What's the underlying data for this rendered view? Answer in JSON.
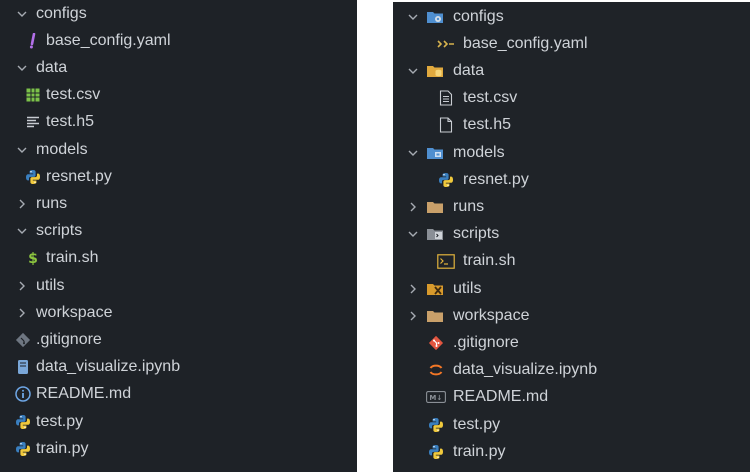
{
  "left_explorer": {
    "items": [
      {
        "label": "configs",
        "icon": "chevron-down-icon",
        "type": "folder-open",
        "depth": 0
      },
      {
        "label": "base_config.yaml",
        "icon": "yaml-exclamation-icon",
        "type": "file",
        "depth": 1
      },
      {
        "label": "data",
        "icon": "chevron-down-icon",
        "type": "folder-open",
        "depth": 0
      },
      {
        "label": "test.csv",
        "icon": "csv-grid-icon",
        "type": "file",
        "depth": 1
      },
      {
        "label": "test.h5",
        "icon": "text-lines-icon",
        "type": "file",
        "depth": 1
      },
      {
        "label": "models",
        "icon": "chevron-down-icon",
        "type": "folder-open",
        "depth": 0
      },
      {
        "label": "resnet.py",
        "icon": "python-icon",
        "type": "file",
        "depth": 1
      },
      {
        "label": "runs",
        "icon": "chevron-right-icon",
        "type": "folder-closed",
        "depth": 0
      },
      {
        "label": "scripts",
        "icon": "chevron-down-icon",
        "type": "folder-open",
        "depth": 0
      },
      {
        "label": "train.sh",
        "icon": "dollar-icon",
        "type": "file",
        "depth": 1
      },
      {
        "label": "utils",
        "icon": "chevron-right-icon",
        "type": "folder-closed",
        "depth": 0
      },
      {
        "label": "workspace",
        "icon": "chevron-right-icon",
        "type": "folder-closed",
        "depth": 0
      },
      {
        "label": ".gitignore",
        "icon": "git-diamond-icon",
        "type": "file",
        "depth": 0
      },
      {
        "label": "data_visualize.ipynb",
        "icon": "notebook-icon",
        "type": "file",
        "depth": 0
      },
      {
        "label": "README.md",
        "icon": "info-icon",
        "type": "file",
        "depth": 0
      },
      {
        "label": "test.py",
        "icon": "python-icon",
        "type": "file",
        "depth": 0
      },
      {
        "label": "train.py",
        "icon": "python-icon",
        "type": "file",
        "depth": 0
      }
    ]
  },
  "right_explorer": {
    "items": [
      {
        "label": "configs",
        "icon": "folder-config-icon",
        "type": "folder-open",
        "depth": 0
      },
      {
        "label": "base_config.yaml",
        "icon": "yaml-icon",
        "type": "file",
        "depth": 1
      },
      {
        "label": "data",
        "icon": "folder-data-icon",
        "type": "folder-open",
        "depth": 0
      },
      {
        "label": "test.csv",
        "icon": "document-lines-icon",
        "type": "file",
        "depth": 1
      },
      {
        "label": "test.h5",
        "icon": "document-blank-icon",
        "type": "file",
        "depth": 1
      },
      {
        "label": "models",
        "icon": "folder-models-icon",
        "type": "folder-open",
        "depth": 0
      },
      {
        "label": "resnet.py",
        "icon": "python-icon",
        "type": "file",
        "depth": 1
      },
      {
        "label": "runs",
        "icon": "folder-icon",
        "type": "folder-closed",
        "depth": 0
      },
      {
        "label": "scripts",
        "icon": "folder-scripts-icon",
        "type": "folder-open",
        "depth": 0
      },
      {
        "label": "train.sh",
        "icon": "terminal-icon",
        "type": "file",
        "depth": 1
      },
      {
        "label": "utils",
        "icon": "folder-utils-icon",
        "type": "folder-closed",
        "depth": 0
      },
      {
        "label": "workspace",
        "icon": "folder-icon",
        "type": "folder-closed",
        "depth": 0
      },
      {
        "label": ".gitignore",
        "icon": "git-icon",
        "type": "file",
        "depth": 0
      },
      {
        "label": "data_visualize.ipynb",
        "icon": "jupyter-icon",
        "type": "file",
        "depth": 0
      },
      {
        "label": "README.md",
        "icon": "markdown-icon",
        "type": "file",
        "depth": 0
      },
      {
        "label": "test.py",
        "icon": "python-icon",
        "type": "file",
        "depth": 0
      },
      {
        "label": "train.py",
        "icon": "python-icon",
        "type": "file",
        "depth": 0
      }
    ]
  },
  "colors": {
    "panel_bg": "#1e2227",
    "text": "#cfd3d8",
    "chevron": "#a6abb2",
    "yaml_exclamation": "#b270e8",
    "csv_green": "#7cc24a",
    "python_blue": "#3a7fbf",
    "python_yellow": "#f0c93c",
    "dollar_green": "#8dc63f",
    "git_gray": "#6e7681",
    "git_red": "#e2553f",
    "info_blue": "#6ea7e6",
    "folder_tan": "#c9a06a",
    "jupyter_orange": "#f37726"
  }
}
